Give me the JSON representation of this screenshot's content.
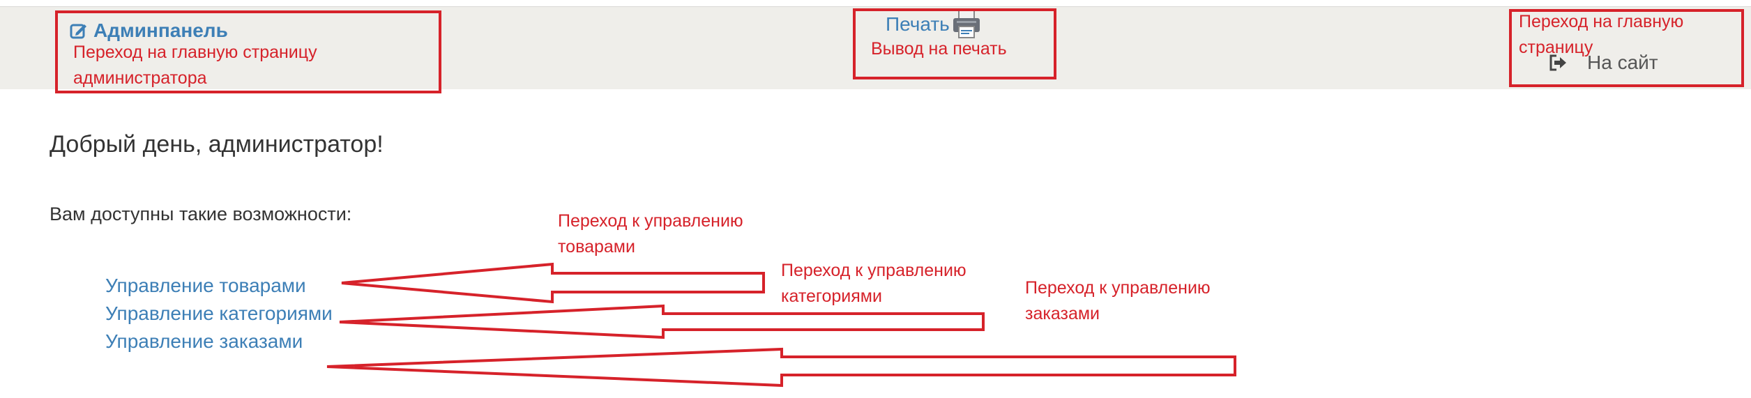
{
  "navbar": {
    "brand_label": "Админпанель",
    "brand_icon": "edit-icon",
    "print_label": "Печать",
    "print_icon": "printer-icon",
    "site_label": "На сайт",
    "site_icon": "sign-out-icon"
  },
  "main": {
    "greeting": "Добрый день, администратор!",
    "intro": "Вам доступны такие возможности:",
    "menu": [
      {
        "label": "Управление товарами"
      },
      {
        "label": "Управление категориями"
      },
      {
        "label": "Управление заказами"
      }
    ]
  },
  "annotations": {
    "admin_line1": "Переход на главную страницу",
    "admin_line2": "администратора",
    "print_line1": "Вывод на печать",
    "site_line1": "Переход на главную",
    "site_line2": "страницу",
    "goods_line1": "Переход к управлению",
    "goods_line2": "товарами",
    "categories_line1": "Переход к управлению",
    "categories_line2": "категориями",
    "orders_line1": "Переход к управлению",
    "orders_line2": "заказами",
    "color": "#d6222a"
  }
}
